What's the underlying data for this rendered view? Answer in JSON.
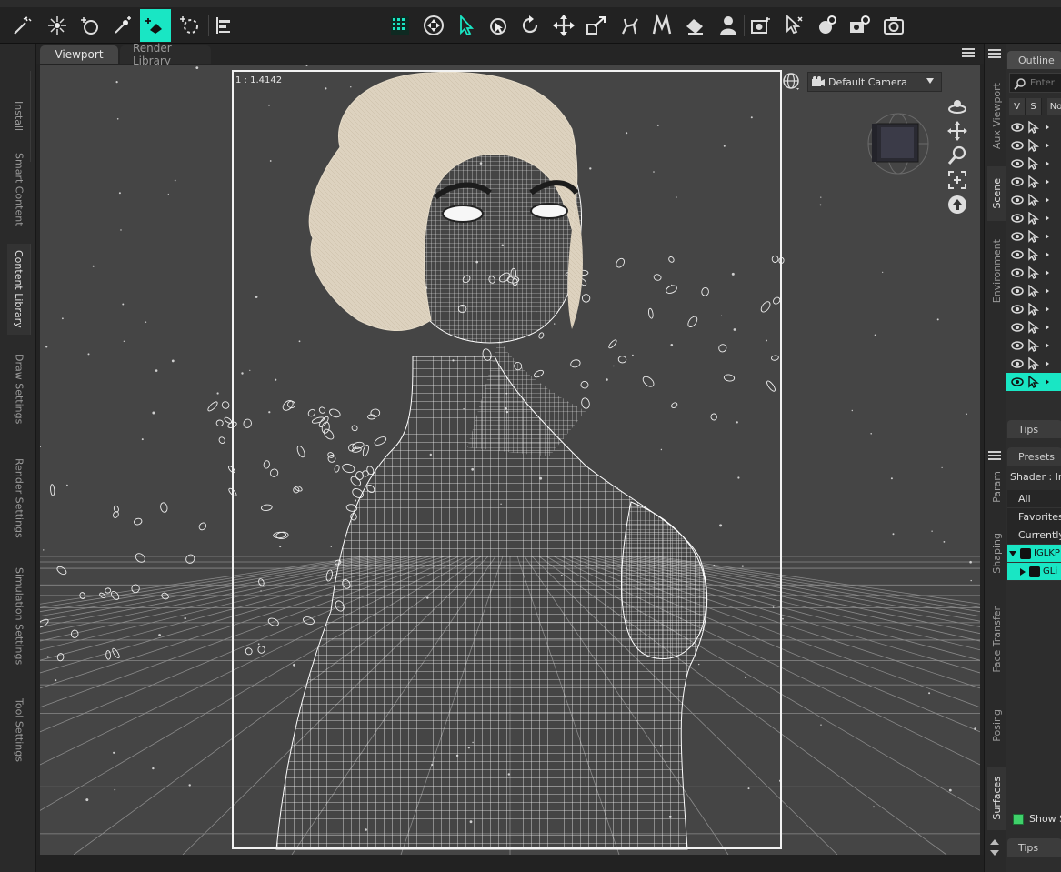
{
  "toolbar": {
    "tools": [
      {
        "name": "node-weight-map-brush-icon"
      },
      {
        "name": "joint-editor-icon"
      },
      {
        "name": "geometry-editor-icon"
      },
      {
        "name": "rigid-follow-icon"
      },
      {
        "name": "surface-selection-icon",
        "active": true
      },
      {
        "name": "transform-origin-icon"
      },
      {
        "name": "align-icon"
      },
      {
        "name": "viewport-grid-icon"
      },
      {
        "name": "universal-tool-icon"
      },
      {
        "name": "node-selection-icon"
      },
      {
        "name": "region-navigator-icon"
      },
      {
        "name": "rotate-tool-icon"
      },
      {
        "name": "translate-tool-icon"
      },
      {
        "name": "scale-tool-icon"
      },
      {
        "name": "active-pose-icon"
      },
      {
        "name": "morph-tool-icon"
      },
      {
        "name": "eraser-tool-icon"
      },
      {
        "name": "figure-tool-icon"
      },
      {
        "name": "camera-render-settings-icon"
      },
      {
        "name": "spot-render-icon"
      },
      {
        "name": "render-settings-icon"
      },
      {
        "name": "render-camera-settings-icon"
      },
      {
        "name": "render-icon"
      }
    ],
    "accent_color": "#19e6c4"
  },
  "left_tabs": [
    "Install",
    "Smart Content",
    "Content Library",
    "Draw Settings",
    "Render Settings",
    "Simulation Settings",
    "Tool Settings"
  ],
  "left_active": "Content Library",
  "center_tabs": [
    "Viewport",
    "Render Library"
  ],
  "center_active": "Viewport",
  "viewport": {
    "ratio_label": "1 : 1.4142",
    "camera": "Default Camera"
  },
  "right_tabs_top": [
    "Aux Viewport",
    "Scene",
    "Environment"
  ],
  "right_tabs_bottom": [
    "Param",
    "Shaping",
    "Face Transfer",
    "Posing",
    "Surfaces"
  ],
  "right_active_top": "Scene",
  "right_active_bottom": "Surfaces",
  "outline": {
    "tab": "Outline",
    "search_placeholder": "Enter",
    "columns": [
      "V",
      "S",
      "No"
    ],
    "row_count": 15,
    "selected_row": 15
  },
  "tips_label": "Tips",
  "surfaces": {
    "presets_tab": "Presets",
    "shader_label": "Shader : Ire",
    "list": [
      "All",
      "Favorites",
      "Currently"
    ],
    "tree": [
      {
        "label": "IGLKP"
      },
      {
        "label": "GLi"
      }
    ],
    "show_label": "Show S"
  },
  "tips_label_bottom": "Tips"
}
